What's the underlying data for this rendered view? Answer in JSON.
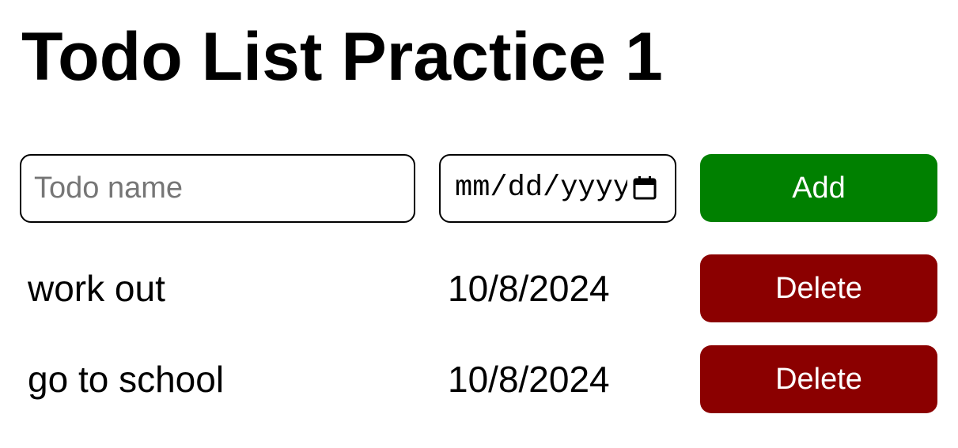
{
  "page": {
    "title": "Todo List Practice 1"
  },
  "form": {
    "name_placeholder": "Todo name",
    "name_value": "",
    "date_placeholder": "mm/dd/yyyy",
    "add_label": "Add"
  },
  "todos": [
    {
      "name": "work out",
      "date": "10/8/2024",
      "delete_label": "Delete"
    },
    {
      "name": "go to school",
      "date": "10/8/2024",
      "delete_label": "Delete"
    }
  ],
  "colors": {
    "add_button": "#008000",
    "delete_button": "#8b0000",
    "text": "#000000",
    "placeholder": "#767676"
  },
  "icons": {
    "date_picker": "calendar-icon"
  }
}
